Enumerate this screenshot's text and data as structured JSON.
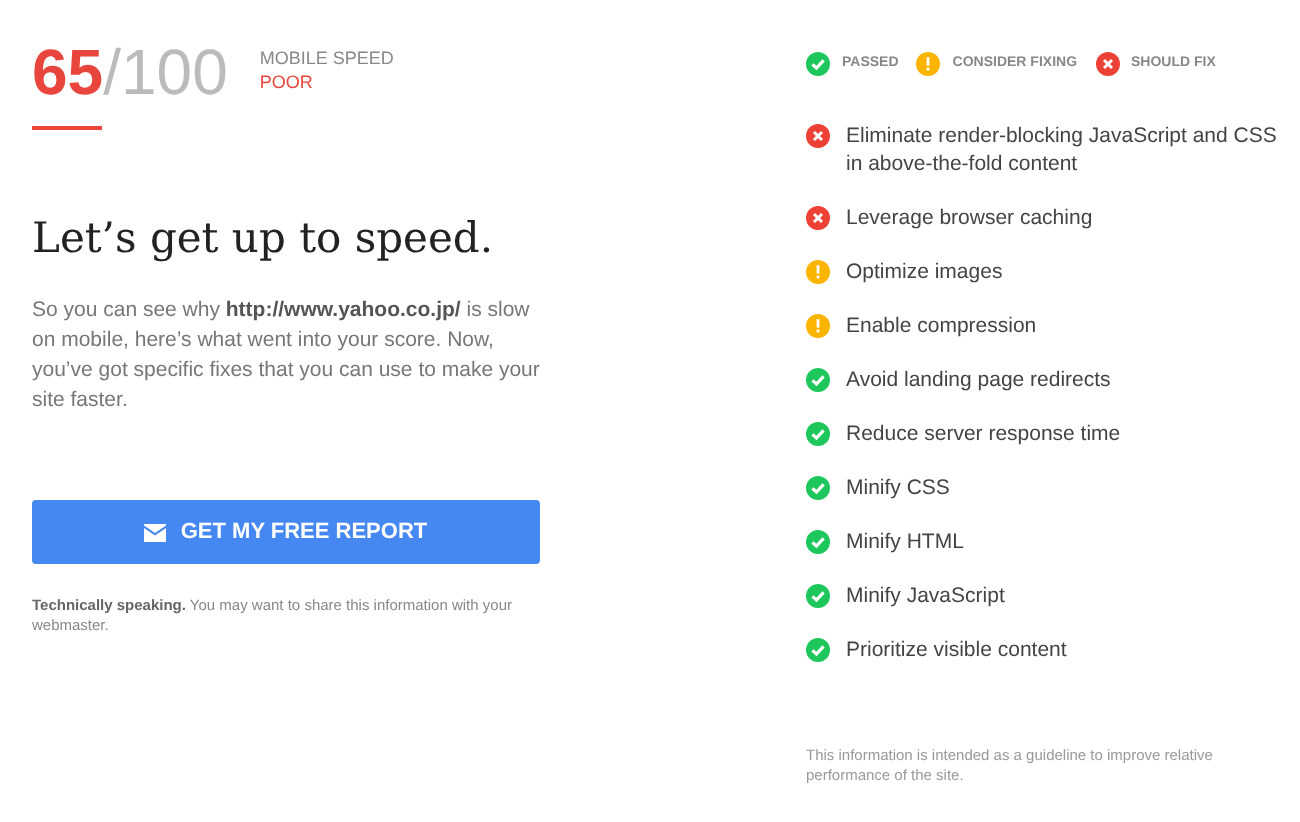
{
  "score": {
    "value": "65",
    "max": "/100",
    "label": "MOBILE SPEED",
    "rating": "POOR"
  },
  "heading": "Let’s get up to speed.",
  "intro": "So you can see why **http://www.yahoo.co.jp/** is slow on mobile, here’s what went into your score. Now, you’ve got specific fixes that you can use to make your site faster.",
  "report_button": "GET MY FREE REPORT",
  "note": "**Technically speaking.** You may want to share this information with your webmaster.",
  "legend": [
    {
      "kind": "pass",
      "label": "PASSED"
    },
    {
      "kind": "consider",
      "label": "CONSIDER FIXING"
    },
    {
      "kind": "fix",
      "label": "SHOULD FIX"
    }
  ],
  "rules": [
    {
      "kind": "fix",
      "label": "Eliminate render-blocking JavaScript and CSS in above-the-fold content"
    },
    {
      "kind": "fix",
      "label": "Leverage browser caching"
    },
    {
      "kind": "consider",
      "label": "Optimize images"
    },
    {
      "kind": "consider",
      "label": "Enable compression"
    },
    {
      "kind": "pass",
      "label": "Avoid landing page redirects"
    },
    {
      "kind": "pass",
      "label": "Reduce server response time"
    },
    {
      "kind": "pass",
      "label": "Minify CSS"
    },
    {
      "kind": "pass",
      "label": "Minify HTML"
    },
    {
      "kind": "pass",
      "label": "Minify JavaScript"
    },
    {
      "kind": "pass",
      "label": "Prioritize visible content"
    }
  ],
  "disclaimer": "This information is intended as a guideline to improve relative performance of the site."
}
